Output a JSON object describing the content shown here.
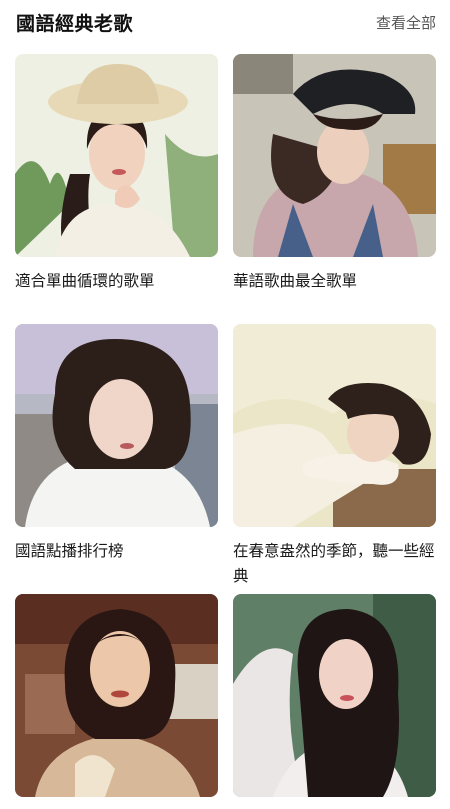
{
  "header": {
    "title": "國語經典老歌",
    "see_all": "查看全部"
  },
  "playlists": [
    {
      "caption": "適合單曲循環的歌單",
      "cover_icon": "portrait-straw-hat-woman"
    },
    {
      "caption": "華語歌曲最全歌單",
      "cover_icon": "portrait-cap-woman"
    },
    {
      "caption": "國語點播排行榜",
      "cover_icon": "portrait-bob-hair-woman"
    },
    {
      "caption": "在春意盎然的季節，聽一些經典",
      "cover_icon": "portrait-resting-woman"
    },
    {
      "caption": "",
      "cover_icon": "portrait-retro-woman"
    },
    {
      "caption": "",
      "cover_icon": "portrait-long-hair-woman"
    }
  ]
}
